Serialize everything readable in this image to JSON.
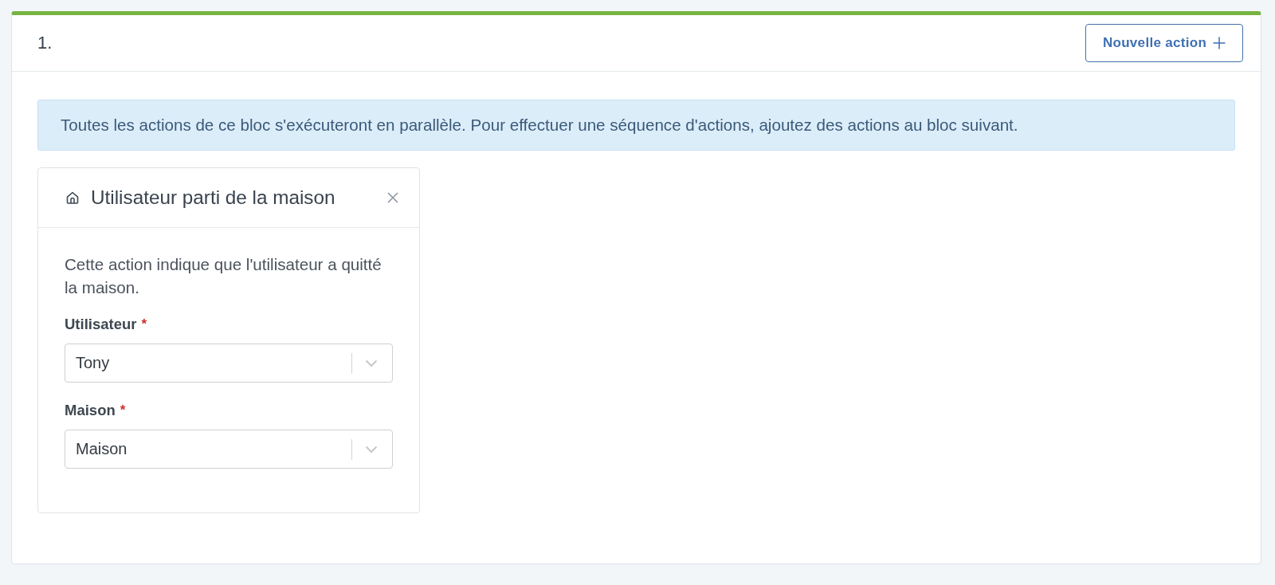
{
  "block": {
    "number": "1.",
    "new_action_button": {
      "label": "Nouvelle action"
    }
  },
  "alert": {
    "text": "Toutes les actions de ce bloc s'exécuteront en parallèle. Pour effectuer une séquence d'actions, ajoutez des actions au bloc suivant."
  },
  "actions": [
    {
      "title": "Utilisateur parti de la maison",
      "description": "Cette action indique que l'utilisateur a quitté la maison.",
      "fields": [
        {
          "label": "Utilisateur",
          "required_mark": "*",
          "value": "Tony"
        },
        {
          "label": "Maison",
          "required_mark": "*",
          "value": "Maison"
        }
      ]
    }
  ]
}
